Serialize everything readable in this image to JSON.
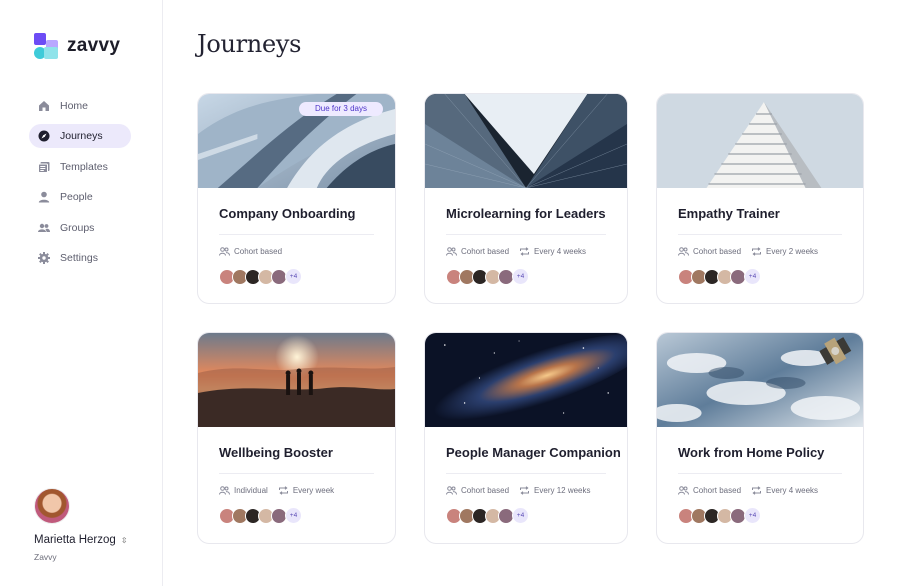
{
  "app": {
    "logo_text": "zavvy"
  },
  "sidebar": {
    "items": [
      {
        "label": "Home",
        "icon": "home-icon",
        "active": false
      },
      {
        "label": "Journeys",
        "icon": "compass-icon",
        "active": true
      },
      {
        "label": "Templates",
        "icon": "templates-icon",
        "active": false
      },
      {
        "label": "People",
        "icon": "person-icon",
        "active": false
      },
      {
        "label": "Groups",
        "icon": "group-icon",
        "active": false
      },
      {
        "label": "Settings",
        "icon": "gear-icon",
        "active": false
      }
    ]
  },
  "profile": {
    "name": "Marietta Herzog",
    "org": "Zavvy"
  },
  "page": {
    "title": "Journeys"
  },
  "cards": [
    {
      "title": "Company Onboarding",
      "badge": "Due for 3 days",
      "type": "Cohort based",
      "frequency": "",
      "more": "+4",
      "image": "architecture-curved-facade"
    },
    {
      "title": "Microlearning for Leaders",
      "badge": "",
      "type": "Cohort based",
      "frequency": "Every 4 weeks",
      "more": "+4",
      "image": "skyscraper-looking-up"
    },
    {
      "title": "Empathy Trainer",
      "badge": "",
      "type": "Cohort based",
      "frequency": "Every 2 weeks",
      "more": "+4",
      "image": "white-pyramid-building"
    },
    {
      "title": "Wellbeing Booster",
      "badge": "",
      "type": "Individual",
      "frequency": "Every week",
      "more": "+4",
      "image": "sunset-hikers"
    },
    {
      "title": "People Manager Companion",
      "badge": "",
      "type": "Cohort based",
      "frequency": "Every 12 weeks",
      "more": "+4",
      "image": "galaxy-night-sky"
    },
    {
      "title": "Work from Home Policy",
      "badge": "",
      "type": "Cohort based",
      "frequency": "Every 4 weeks",
      "more": "+4",
      "image": "earth-from-orbit"
    }
  ],
  "colors": {
    "accent": "#6d4cf5",
    "active_bg": "#ece9fb",
    "badge_bg": "#eeeaff",
    "badge_text": "#4d34c9"
  }
}
